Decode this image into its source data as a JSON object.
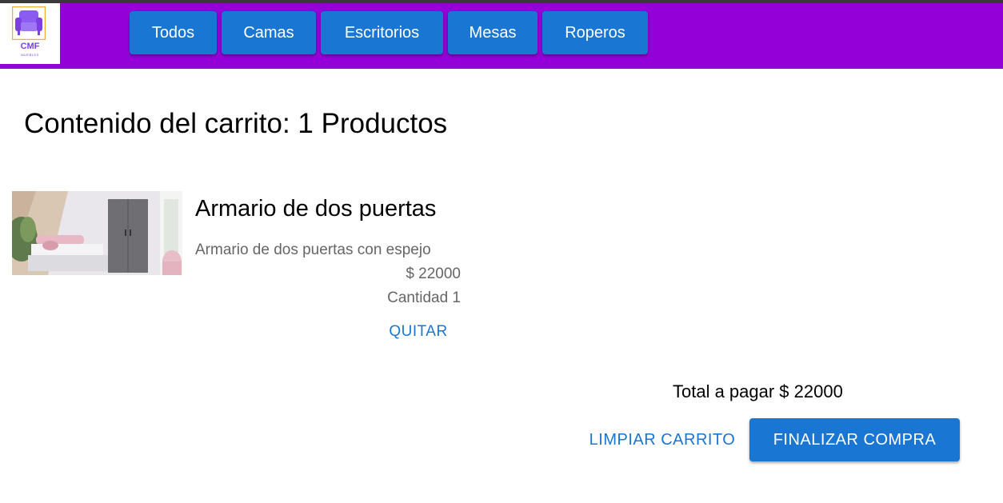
{
  "colors": {
    "navbar": "#9400d8",
    "primary": "#1976d2",
    "logo_accent": "#7b3fe4"
  },
  "logo": {
    "text": "CMF",
    "subtext": "MUEBLES",
    "icon": "sofa-icon"
  },
  "nav": {
    "items": [
      {
        "label": "Todos"
      },
      {
        "label": "Camas"
      },
      {
        "label": "Escritorios"
      },
      {
        "label": "Mesas"
      },
      {
        "label": "Roperos"
      }
    ]
  },
  "cart": {
    "title": "Contenido del carrito: 1 Productos",
    "items": [
      {
        "name": "Armario de dos puertas",
        "description": "Armario de dos puertas con espejo",
        "price": "$ 22000",
        "quantity": "Cantidad 1",
        "remove_label": "QUITAR"
      }
    ],
    "total": "Total a pagar $ 22000",
    "clear_label": "LIMPIAR CARRITO",
    "checkout_label": "FINALIZAR COMPRA"
  }
}
